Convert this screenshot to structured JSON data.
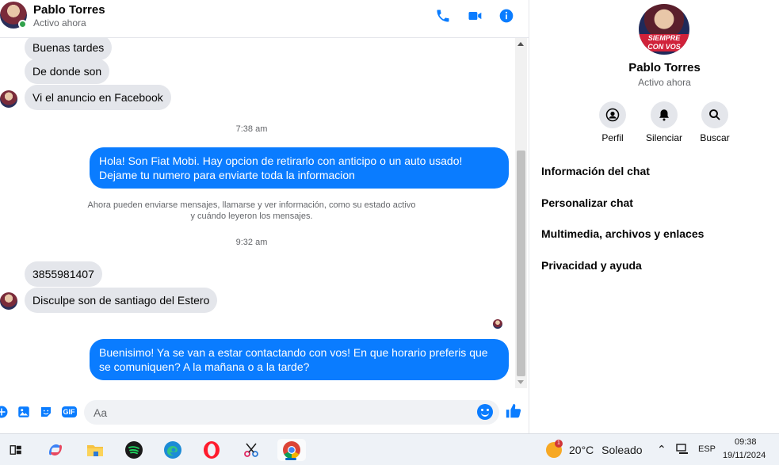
{
  "header": {
    "name": "Pablo Torres",
    "status": "Activo ahora",
    "call_icon": "phone-icon",
    "video_icon": "video-camera-icon",
    "info_icon": "info-icon"
  },
  "messages": {
    "incoming_1": "Buenas tardes",
    "incoming_2": "De donde son",
    "incoming_3": "Vi el anuncio en Facebook",
    "time_1": "7:38 am",
    "outgoing_1": "Hola! Son Fiat Mobi. Hay opcion de retirarlo con anticipo o un auto usado! Dejame tu numero para enviarte toda la informacion",
    "system_line_1": "Ahora pueden enviarse mensajes, llamarse y ver información, como su estado activo",
    "system_line_2": "y cuándo leyeron los mensajes.",
    "time_2": "9:32 am",
    "incoming_4": "3855981407",
    "incoming_5": "Disculpe son de santiago del Estero",
    "outgoing_2": "Buenisimo! Ya se van a estar contactando con vos! En que horario preferis que se comuniquen? A la mañana o a la tarde?"
  },
  "composer": {
    "placeholder": "Aa",
    "gif_label": "GIF"
  },
  "info_panel": {
    "name": "Pablo Torres",
    "status": "Activo ahora",
    "avatar_text": "SIEMPRE CON VOS",
    "actions": [
      {
        "label": "Perfil",
        "icon": "profile-icon"
      },
      {
        "label": "Silenciar",
        "icon": "bell-icon"
      },
      {
        "label": "Buscar",
        "icon": "search-icon"
      }
    ],
    "menu": [
      "Información del chat",
      "Personalizar chat",
      "Multimedia, archivos y enlaces",
      "Privacidad y ayuda"
    ]
  },
  "taskbar": {
    "weather_temp": "20°C",
    "weather_desc": "Soleado",
    "weather_badge": "1",
    "language": "ESP",
    "time": "09:38",
    "date": "19/11/2024"
  },
  "colors": {
    "accent": "#0a7cff",
    "bubble_in": "#e4e6eb",
    "online": "#31a24c"
  }
}
